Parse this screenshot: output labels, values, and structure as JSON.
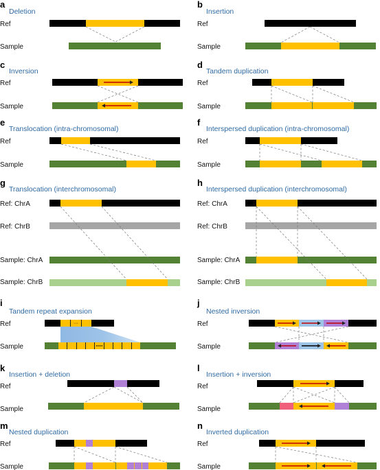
{
  "colors": {
    "ref": "#000000",
    "sample": "#548235",
    "sv": "#ffc000",
    "chrB_ref": "#a6a6a6",
    "chrB_sample": "#a9d18e",
    "purple": "#b07fd6",
    "light_blue": "#9dc3e6",
    "pink": "#f0607a",
    "arrow_red": "#c00000",
    "arrow_black": "#000000",
    "title": "#2f6aa3"
  },
  "panels": [
    {
      "id": "a",
      "letter": "a",
      "title": "Deletion",
      "rows": [
        "Ref",
        "Sample"
      ]
    },
    {
      "id": "b",
      "letter": "b",
      "title": "Insertion",
      "rows": [
        "Ref",
        "Sample"
      ]
    },
    {
      "id": "c",
      "letter": "c",
      "title": "Inversion",
      "rows": [
        "Ref",
        "Sample"
      ]
    },
    {
      "id": "d",
      "letter": "d",
      "title": "Tandem duplication",
      "rows": [
        "Ref",
        "Sample"
      ]
    },
    {
      "id": "e",
      "letter": "e",
      "title": "Translocation (intra-chromosomal)",
      "rows": [
        "Ref",
        "Sample"
      ]
    },
    {
      "id": "f",
      "letter": "f",
      "title": "Interspersed duplication (intra-chromosomal)",
      "rows": [
        "Ref",
        "Sample"
      ]
    },
    {
      "id": "g",
      "letter": "g",
      "title": "Translocation (interchromosomal)",
      "rows": [
        "Ref: ChrA",
        "Ref: ChrB",
        "Sample: ChrA",
        "Sample: ChrB"
      ]
    },
    {
      "id": "h",
      "letter": "h",
      "title": "Interspersed duplication (interchromosomal)",
      "rows": [
        "Ref: ChrA",
        "Ref: ChrB",
        "Sample: ChrA",
        "Sample: ChrB"
      ]
    },
    {
      "id": "i",
      "letter": "i",
      "title": "Tandem repeat expansion",
      "rows": [
        "Ref",
        "Sample"
      ],
      "ellipsis": "···"
    },
    {
      "id": "j",
      "letter": "j",
      "title": "Nested inversion",
      "rows": [
        "Ref",
        "Sample"
      ]
    },
    {
      "id": "k",
      "letter": "k",
      "title": "Insertion + deletion",
      "rows": [
        "Ref",
        "Sample"
      ]
    },
    {
      "id": "l",
      "letter": "l",
      "title": "Insertion + inversion",
      "rows": [
        "Ref",
        "Sample"
      ]
    },
    {
      "id": "m",
      "letter": "m",
      "title": "Nested duplication",
      "rows": [
        "Ref",
        "Sample"
      ]
    },
    {
      "id": "n",
      "letter": "n",
      "title": "Inverted duplication",
      "rows": [
        "Ref",
        "Sample"
      ]
    }
  ]
}
